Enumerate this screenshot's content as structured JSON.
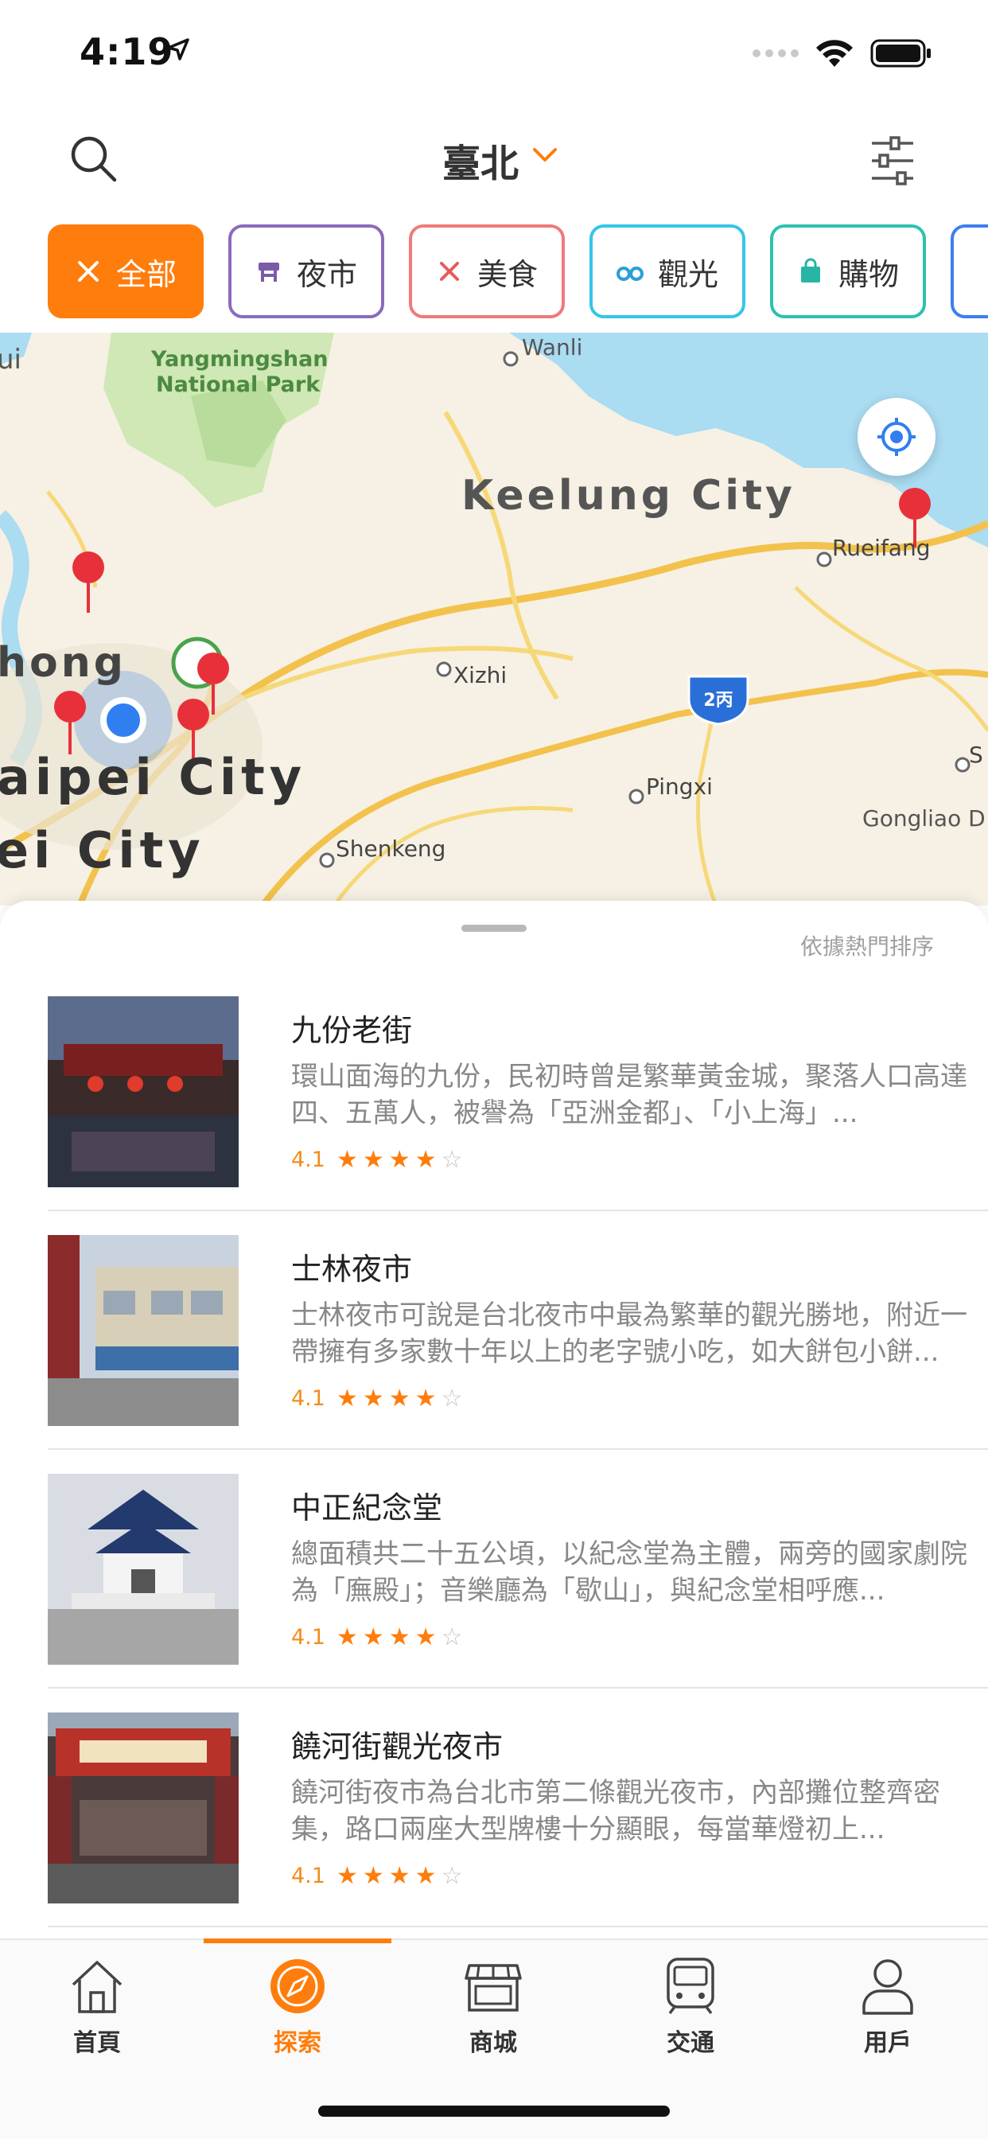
{
  "status_bar": {
    "time": "4:19"
  },
  "header": {
    "city": "臺北"
  },
  "categories": [
    {
      "label": "全部",
      "icon": "utensils-icon",
      "color": "#ff7d0c",
      "active": true
    },
    {
      "label": "夜市",
      "icon": "stall-icon",
      "color": "#8a6bbd",
      "active": false
    },
    {
      "label": "美食",
      "icon": "fork-knife-icon",
      "color": "#f07a7a",
      "active": false
    },
    {
      "label": "觀光",
      "icon": "binoculars-icon",
      "color": "#34c6e6",
      "active": false
    },
    {
      "label": "購物",
      "icon": "shopping-bag-icon",
      "color": "#2fc0b0",
      "active": false
    }
  ],
  "map": {
    "labels": {
      "wanli": "Wanli",
      "yangmingshan_1": "Yangmingshan",
      "yangmingshan_2": "National Park",
      "keelung": "Keelung City",
      "rueifang": "Rueifang",
      "xizhi": "Xizhi",
      "pingxi": "Pingxi",
      "shenkeng": "Shenkeng",
      "gongliao": "Gongliao D",
      "taipei": "aipei City",
      "newtaipei": "ei City",
      "zhong": "hong",
      "ui": "ui",
      "highway": "2丙",
      "s_edge": "S"
    }
  },
  "sheet": {
    "sort_label": "依據熱門排序",
    "items": [
      {
        "title": "九份老街",
        "desc": "環山面海的九份，民初時曾是繁華黃金城，聚落人口高達四、五萬人，被譽為「亞洲金都」、「小上海」...",
        "rating": "4.1",
        "stars": 4
      },
      {
        "title": "士林夜市",
        "desc": "士林夜市可說是台北夜市中最為繁華的觀光勝地，附近一帶擁有多家數十年以上的老字號小吃，如大餅包小餅...",
        "rating": "4.1",
        "stars": 4
      },
      {
        "title": "中正紀念堂",
        "desc": "總面積共二十五公頃，以紀念堂為主體，兩旁的國家劇院為「廡殿」；音樂廳為「歇山」，與紀念堂相呼應...",
        "rating": "4.1",
        "stars": 4
      },
      {
        "title": "饒河街觀光夜市",
        "desc": "饒河街夜市為台北市第二條觀光夜市，內部攤位整齊密集，路口兩座大型牌樓十分顯眼，每當華燈初上...",
        "rating": "4.1",
        "stars": 4
      }
    ]
  },
  "tabs": [
    {
      "label": "首頁",
      "icon": "home-icon",
      "active": false
    },
    {
      "label": "探索",
      "icon": "compass-icon",
      "active": true
    },
    {
      "label": "商城",
      "icon": "store-icon",
      "active": false
    },
    {
      "label": "交通",
      "icon": "train-icon",
      "active": false
    },
    {
      "label": "用戶",
      "icon": "user-icon",
      "active": false
    }
  ],
  "colors": {
    "accent": "#ff7d0c",
    "pin": "#e8303a",
    "location": "#2f7ff0"
  }
}
